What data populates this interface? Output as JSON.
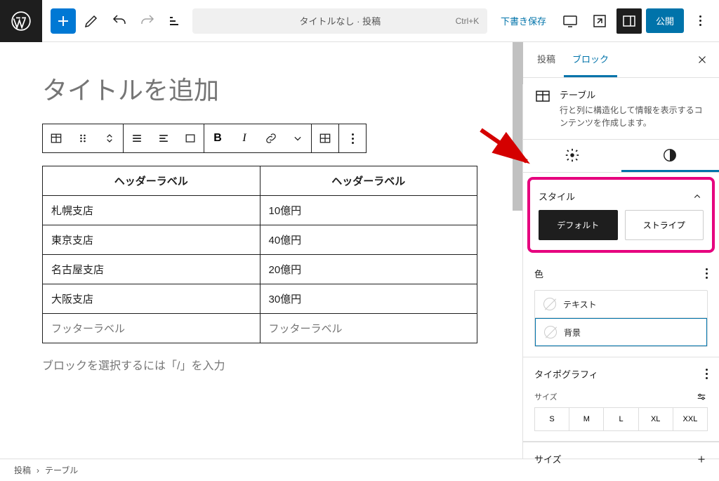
{
  "topbar": {
    "doc_title": "タイトルなし · 投稿",
    "shortcut": "Ctrl+K",
    "save_draft": "下書き保存",
    "publish": "公開"
  },
  "editor": {
    "title_placeholder": "タイトルを追加",
    "table": {
      "header": [
        "ヘッダーラベル",
        "ヘッダーラベル"
      ],
      "rows": [
        [
          "札幌支店",
          "10億円"
        ],
        [
          "東京支店",
          "40億円"
        ],
        [
          "名古屋支店",
          "20億円"
        ],
        [
          "大阪支店",
          "30億円"
        ]
      ],
      "footer": [
        "フッターラベル",
        "フッターラベル"
      ]
    },
    "prompt": "ブロックを選択するには「/」を入力"
  },
  "sidebar": {
    "tabs": {
      "post": "投稿",
      "block": "ブロック"
    },
    "block_info": {
      "title": "テーブル",
      "desc": "行と列に構造化して情報を表示するコンテンツを作成します。"
    },
    "style_panel": {
      "title": "スタイル",
      "default": "デフォルト",
      "stripes": "ストライプ"
    },
    "color_panel": {
      "title": "色",
      "text": "テキスト",
      "background": "背景"
    },
    "typo_panel": {
      "title": "タイポグラフィ",
      "size_label": "サイズ",
      "sizes": [
        "S",
        "M",
        "L",
        "XL",
        "XXL"
      ]
    },
    "size_panel": {
      "title": "サイズ"
    }
  },
  "breadcrumb": {
    "post": "投稿",
    "sep": "›",
    "table": "テーブル"
  }
}
